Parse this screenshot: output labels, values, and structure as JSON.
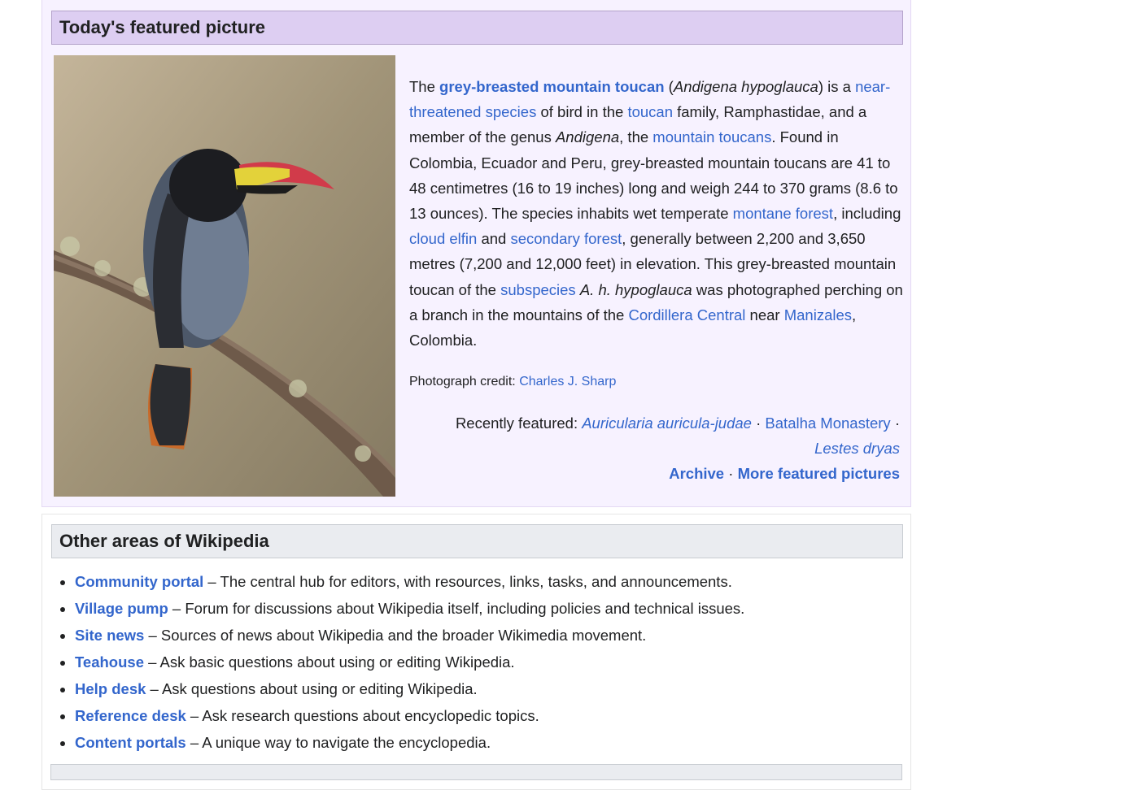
{
  "featured": {
    "heading": "Today's featured picture",
    "image_alt": "Grey-breasted mountain toucan perched on a mossy branch",
    "text": {
      "p1": "The ",
      "l1": "grey-breasted mountain toucan",
      "p2": " (",
      "p3": "Andigena hypoglauca",
      "p4": ") is a ",
      "l2": "near-threatened species",
      "p5": " of bird in the ",
      "l3": "toucan",
      "p6": " family, Ramphastidae, and a member of the genus ",
      "p7": "Andigena",
      "p8": ", the ",
      "l4": "mountain toucans",
      "p9": ". Found in Colombia, Ecuador and Peru, grey-breasted mountain toucans are 41 to 48 centimetres (16 to 19 inches) long and weigh 244 to 370 grams (8.6 to 13 ounces). The species ",
      "l5": "inhabits",
      "p10": " wet temperate ",
      "l6": "montane forest",
      "p11": ", including ",
      "l7": "cloud",
      "p12": " ",
      "l8": "elfin",
      "p13": " and ",
      "l9": "secondary forest",
      "p14": ", generally between 2,200 and 3,650 metres (7,200 and 12,000 feet) in elevation. This grey-breasted mountain toucan of the ",
      "l10": "subspecies",
      "p15": " ",
      "p16": "A. h. hypoglauca",
      "p17": " was photographed perching on a branch in the mountains of the ",
      "l11": "Cordillera Central",
      "p18": " near ",
      "l12": "Manizales",
      "p19": ", Colombia."
    },
    "credit_label": "Photograph credit: ",
    "credit_name": "Charles J. Sharp",
    "recent_label": "Recently featured: ",
    "recent_items": [
      "Auricularia auricula-judae",
      "Batalha Monastery",
      "Lestes dryas"
    ],
    "sep": " · ",
    "archive_label": "Archive",
    "more_label": "More featured pictures"
  },
  "other_areas": {
    "heading": "Other areas of Wikipedia",
    "items": [
      {
        "link": "Community portal",
        "desc": " – The central hub for editors, with resources, links, tasks, and announcements."
      },
      {
        "link": "Village pump",
        "desc": " – Forum for discussions about Wikipedia itself, including policies and technical issues."
      },
      {
        "link": "Site news",
        "desc": " – Sources of news about Wikipedia and the broader Wikimedia movement."
      },
      {
        "link": "Teahouse",
        "desc": " – Ask basic questions about using or editing Wikipedia."
      },
      {
        "link": "Help desk",
        "desc": " – Ask questions about using or editing Wikipedia."
      },
      {
        "link": "Reference desk",
        "desc": " – Ask research questions about encyclopedic topics."
      },
      {
        "link": "Content portals",
        "desc": " – A unique way to navigate the encyclopedia."
      }
    ]
  }
}
